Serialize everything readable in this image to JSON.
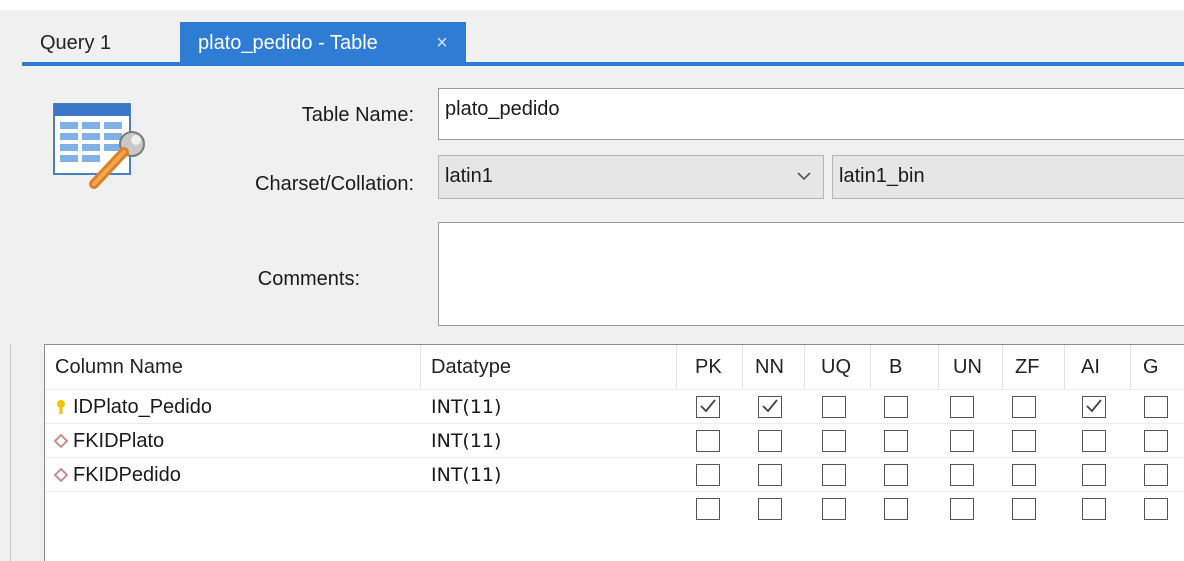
{
  "tabs": [
    {
      "label": "Query 1",
      "active": false
    },
    {
      "label": "plato_pedido - Table",
      "active": true
    }
  ],
  "tab_close_glyph": "×",
  "form": {
    "table_name_label": "Table Name:",
    "table_name_value": "plato_pedido",
    "charset_label": "Charset/Collation:",
    "charset_value": "latin1",
    "collation_value": "latin1_bin",
    "comments_label": "Comments:",
    "comments_value": ""
  },
  "grid": {
    "headers": [
      "Column Name",
      "Datatype",
      "PK",
      "NN",
      "UQ",
      "B",
      "UN",
      "ZF",
      "AI",
      "G"
    ],
    "flag_keys": [
      "PK",
      "NN",
      "UQ",
      "B",
      "UN",
      "ZF",
      "AI",
      "G"
    ],
    "rows": [
      {
        "name": "IDPlato_Pedido",
        "datatype": "INT(11)",
        "icon": "primary-key-icon",
        "flags": [
          true,
          true,
          false,
          false,
          false,
          false,
          true,
          false
        ]
      },
      {
        "name": "FKIDPlato",
        "datatype": "INT(11)",
        "icon": "column-diamond-icon",
        "flags": [
          false,
          false,
          false,
          false,
          false,
          false,
          false,
          false
        ]
      },
      {
        "name": "FKIDPedido",
        "datatype": "INT(11)",
        "icon": "column-diamond-icon",
        "flags": [
          false,
          false,
          false,
          false,
          false,
          false,
          false,
          false
        ]
      },
      {
        "name": "",
        "datatype": "",
        "icon": "",
        "flags": [
          false,
          false,
          false,
          false,
          false,
          false,
          false,
          false
        ]
      }
    ]
  },
  "colors": {
    "accent": "#2e7cd3",
    "key_icon": "#f2c200",
    "diamond_icon": "#c98f8f"
  }
}
